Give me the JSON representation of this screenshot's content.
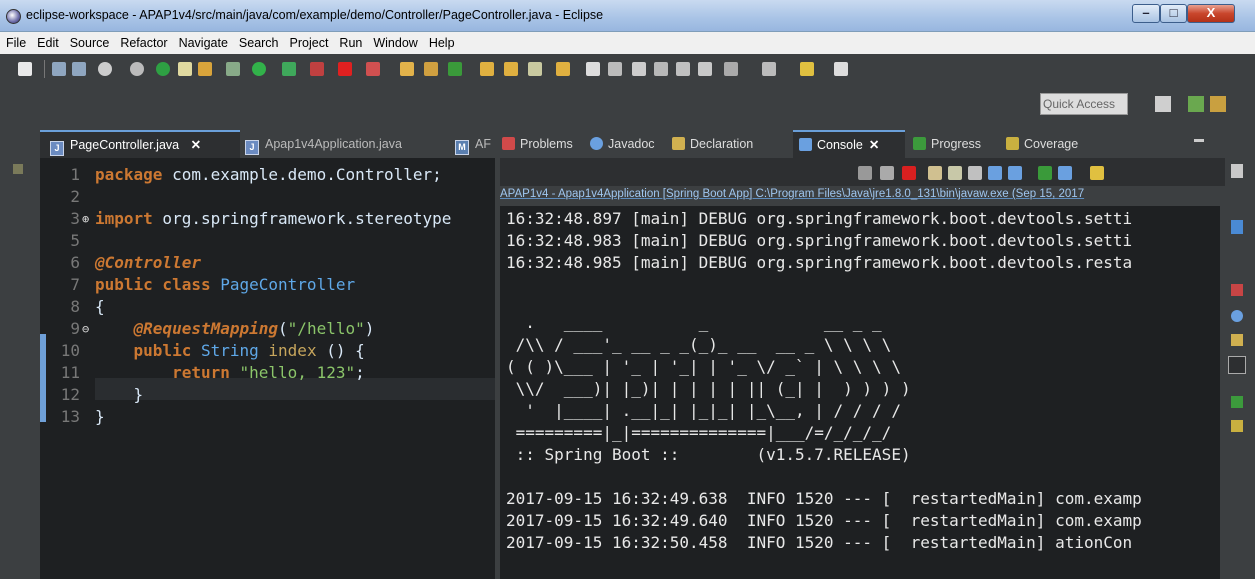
{
  "window": {
    "title": "eclipse-workspace - APAP1v4/src/main/java/com/example/demo/Controller/PageController.java - Eclipse",
    "min": "–",
    "max": "□",
    "close": "X"
  },
  "menu": [
    "File",
    "Edit",
    "Source",
    "Refactor",
    "Navigate",
    "Search",
    "Project",
    "Run",
    "Window",
    "Help"
  ],
  "toolbar": {
    "quick_access": "Quick Access"
  },
  "editor": {
    "tabs": [
      {
        "label": "PageController.java",
        "close": "✕",
        "icon": "java-file-icon"
      },
      {
        "label": "Apap1v4Application.java",
        "icon": "java-file-icon"
      },
      {
        "label": "AF",
        "icon": "maven-file-icon"
      }
    ],
    "lines": [
      {
        "num": "1",
        "text": "package com.example.demo.Controller;"
      },
      {
        "num": "2",
        "text": ""
      },
      {
        "num": "3",
        "text": "import org.springframework.stereotype"
      },
      {
        "num": "5",
        "text": ""
      },
      {
        "num": "6",
        "text": "@Controller"
      },
      {
        "num": "7",
        "text": "public class PageController"
      },
      {
        "num": "8",
        "text": "{"
      },
      {
        "num": "9",
        "text": "    @RequestMapping(\"/hello\")"
      },
      {
        "num": "10",
        "text": "    public String index () {"
      },
      {
        "num": "11",
        "text": "        return \"hello, 123\";"
      },
      {
        "num": "12",
        "text": "    }"
      },
      {
        "num": "13",
        "text": "}"
      }
    ]
  },
  "console": {
    "tabs": [
      {
        "label": "Problems",
        "icon": "problems-icon"
      },
      {
        "label": "Javadoc",
        "icon": "javadoc-icon"
      },
      {
        "label": "Declaration",
        "icon": "declaration-icon"
      },
      {
        "label": "Console",
        "close": "✕",
        "icon": "console-icon"
      },
      {
        "label": "Progress",
        "icon": "progress-icon"
      },
      {
        "label": "Coverage",
        "icon": "coverage-icon"
      }
    ],
    "description": "APAP1v4 - Apap1v4Application [Spring Boot App] C:\\Program Files\\Java\\jre1.8.0_131\\bin\\javaw.exe (Sep 15, 2017",
    "lines": [
      "16:32:48.897 [main] DEBUG org.springframework.boot.devtools.setti",
      "16:32:48.983 [main] DEBUG org.springframework.boot.devtools.setti",
      "16:32:48.985 [main] DEBUG org.springframework.boot.devtools.resta",
      "",
      "",
      "  .   ____          _            __ _ _",
      " /\\\\ / ___'_ __ _ _(_)_ __  __ _ \\ \\ \\ \\",
      "( ( )\\___ | '_ | '_| | '_ \\/ _` | \\ \\ \\ \\",
      " \\\\/  ___)| |_)| | | | | || (_| |  ) ) ) )",
      "  '  |____| .__|_| |_|_| |_\\__, | / / / /",
      " =========|_|==============|___/=/_/_/_/",
      " :: Spring Boot ::        (v1.5.7.RELEASE)",
      "",
      "2017-09-15 16:32:49.638  INFO 1520 --- [  restartedMain] com.examp",
      "2017-09-15 16:32:49.640  INFO 1520 --- [  restartedMain] com.examp",
      "2017-09-15 16:32:50.458  INFO 1520 --- [  restartedMain] ationCon"
    ]
  }
}
